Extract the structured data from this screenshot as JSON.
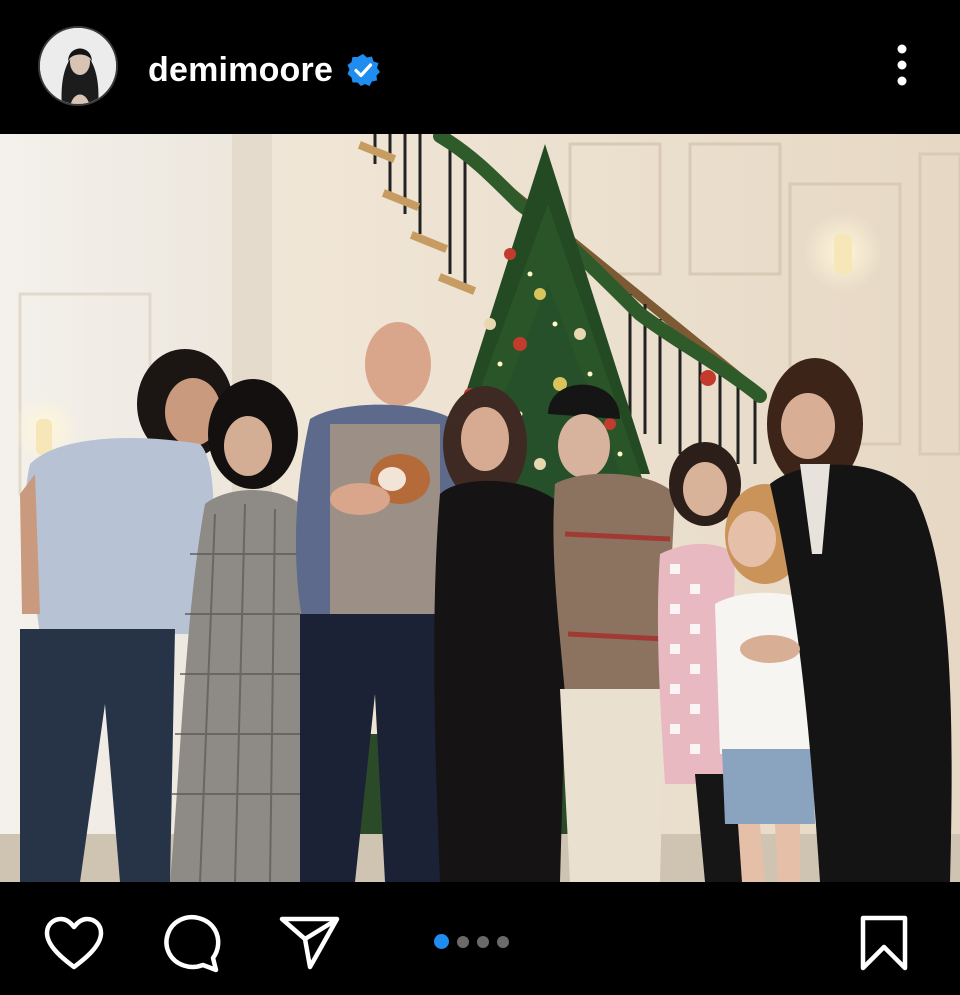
{
  "post": {
    "username": "demimoore",
    "verified": true,
    "avatar": "profile-avatar",
    "photo_alt_icon": "family-christmas-photo",
    "carousel": {
      "count": 4,
      "active_index": 0
    }
  },
  "actions": {
    "like_icon": "heart-icon",
    "comment_icon": "comment-icon",
    "share_icon": "send-icon",
    "save_icon": "bookmark-icon",
    "more_icon": "more-vertical-icon"
  },
  "colors": {
    "background": "#000000",
    "verified_badge": "#1f8cf0",
    "carousel_active": "#1f8cf0",
    "carousel_inactive": "#6a6a6a"
  }
}
